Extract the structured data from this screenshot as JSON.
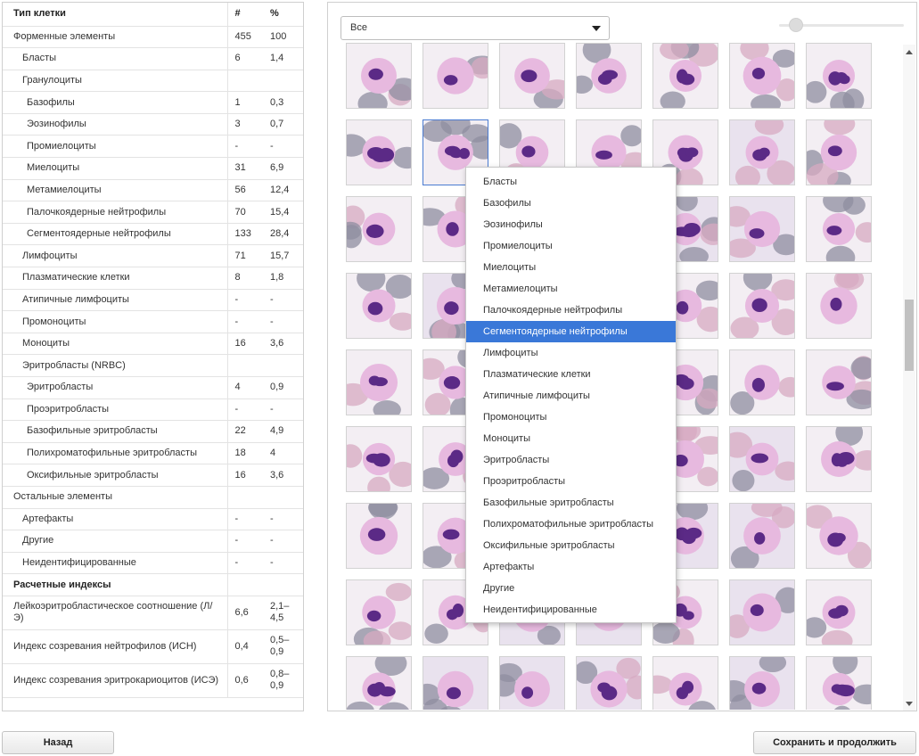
{
  "table": {
    "headers": {
      "name": "Тип клетки",
      "count": "#",
      "percent": "%"
    },
    "rows": [
      {
        "name": "Форменные элементы",
        "count": "455",
        "percent": "100",
        "level": 0,
        "bold": false
      },
      {
        "name": "Бласты",
        "count": "6",
        "percent": "1,4",
        "level": 1
      },
      {
        "name": "Гранулоциты",
        "count": "",
        "percent": "",
        "level": 1
      },
      {
        "name": "Базофилы",
        "count": "1",
        "percent": "0,3",
        "level": 2
      },
      {
        "name": "Эозинофилы",
        "count": "3",
        "percent": "0,7",
        "level": 2
      },
      {
        "name": "Промиелоциты",
        "count": "-",
        "percent": "-",
        "level": 2
      },
      {
        "name": "Миелоциты",
        "count": "31",
        "percent": "6,9",
        "level": 2
      },
      {
        "name": "Метамиелоциты",
        "count": "56",
        "percent": "12,4",
        "level": 2
      },
      {
        "name": "Палочкоядерные нейтрофилы",
        "count": "70",
        "percent": "15,4",
        "level": 2
      },
      {
        "name": "Сегментоядерные нейтрофилы",
        "count": "133",
        "percent": "28,4",
        "level": 2
      },
      {
        "name": "Лимфоциты",
        "count": "71",
        "percent": "15,7",
        "level": 1
      },
      {
        "name": "Плазматические клетки",
        "count": "8",
        "percent": "1,8",
        "level": 1
      },
      {
        "name": "Атипичные лимфоциты",
        "count": "-",
        "percent": "-",
        "level": 1
      },
      {
        "name": "Промоноциты",
        "count": "-",
        "percent": "-",
        "level": 1
      },
      {
        "name": "Моноциты",
        "count": "16",
        "percent": "3,6",
        "level": 1
      },
      {
        "name": "Эритробласты (NRBC)",
        "count": "",
        "percent": "",
        "level": 1
      },
      {
        "name": "Эритробласты",
        "count": "4",
        "percent": "0,9",
        "level": 2
      },
      {
        "name": "Проэритробласты",
        "count": "-",
        "percent": "-",
        "level": 2
      },
      {
        "name": "Базофильные эритробласты",
        "count": "22",
        "percent": "4,9",
        "level": 2
      },
      {
        "name": "Полихроматофильные эритробласты",
        "count": "18",
        "percent": "4",
        "level": 2
      },
      {
        "name": "Оксифильные эритробласты",
        "count": "16",
        "percent": "3,6",
        "level": 2
      },
      {
        "name": "Остальные элементы",
        "count": "",
        "percent": "",
        "level": 0
      },
      {
        "name": "Артефакты",
        "count": "-",
        "percent": "-",
        "level": 1
      },
      {
        "name": "Другие",
        "count": "-",
        "percent": "-",
        "level": 1
      },
      {
        "name": "Неидентифицированные",
        "count": "-",
        "percent": "-",
        "level": 1
      }
    ],
    "indices_title": "Расчетные индексы",
    "indices": [
      {
        "name": "Лейкоэритробластическое соотношение (Л/Э)",
        "count": "6,6",
        "percent": "2,1–4,5"
      },
      {
        "name": "Индекс созревания нейтрофилов (ИСН)",
        "count": "0,4",
        "percent": "0,5–0,9"
      },
      {
        "name": "Индекс созревания эритрокариоцитов (ИСЭ)",
        "count": "0,6",
        "percent": "0,8–0,9"
      }
    ]
  },
  "filter": {
    "selected": "Все"
  },
  "zoom": {
    "level": 0.08
  },
  "menu": {
    "items": [
      "Бласты",
      "Базофилы",
      "Эозинофилы",
      "Промиелоциты",
      "Миелоциты",
      "Метамиелоциты",
      "Палочкоядерные нейтрофилы",
      "Сегментоядерные нейтрофилы",
      "Лимфоциты",
      "Плазматические клетки",
      "Атипичные лимфоциты",
      "Промоноциты",
      "Моноциты",
      "Эритробласты",
      "Проэритробласты",
      "Базофильные эритробласты",
      "Полихроматофильные эритробласты",
      "Оксифильные эритробласты",
      "Артефакты",
      "Другие",
      "Неидентифицированные"
    ],
    "active_index": 7
  },
  "buttons": {
    "back": "Назад",
    "save": "Сохранить и продолжить"
  },
  "colors": {
    "accent": "#3a78d8",
    "selected_border": "#4a7bd1",
    "nucleus": "#5b2a86",
    "cytoplasm": "#e7b9df",
    "rbc": "#d9a9c2"
  }
}
